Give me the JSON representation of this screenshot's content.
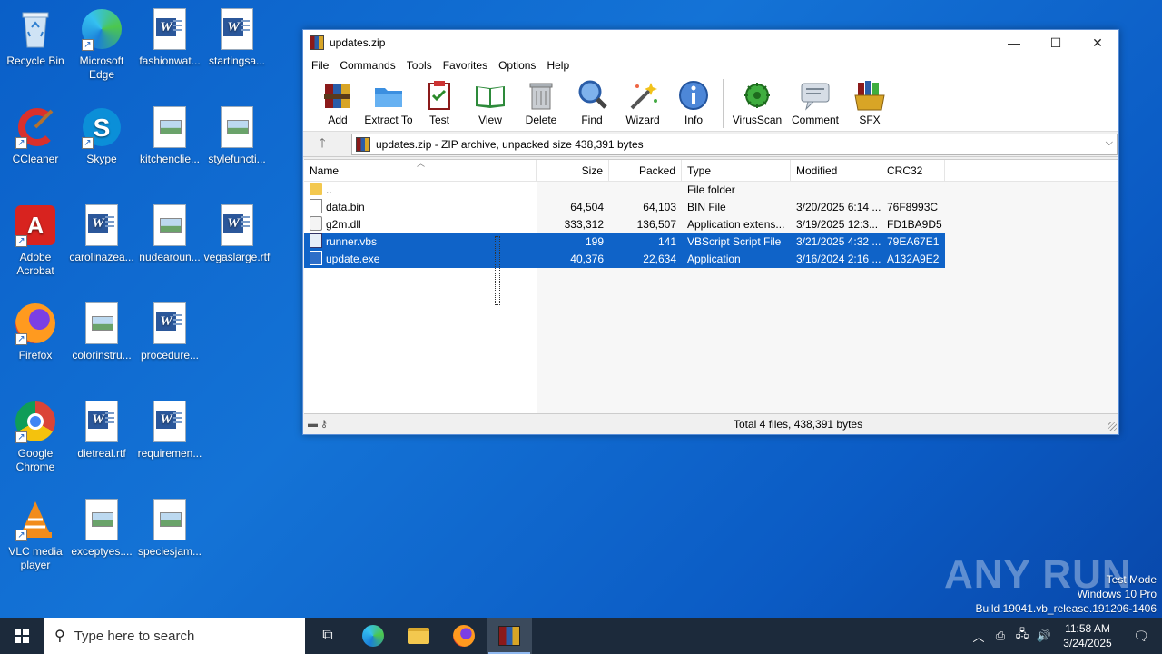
{
  "desktop": {
    "icons": [
      {
        "label": "Recycle Bin"
      },
      {
        "label": "Microsoft Edge"
      },
      {
        "label": "fashionwat..."
      },
      {
        "label": "startingsa..."
      },
      {
        "label": "CCleaner"
      },
      {
        "label": "Skype"
      },
      {
        "label": "kitchenclie..."
      },
      {
        "label": "stylefuncti..."
      },
      {
        "label": "Adobe Acrobat"
      },
      {
        "label": "carolinazea..."
      },
      {
        "label": "nudearoun..."
      },
      {
        "label": "vegaslarge.rtf"
      },
      {
        "label": "Firefox"
      },
      {
        "label": "colorinstru..."
      },
      {
        "label": "procedure..."
      },
      {
        "label": "Google Chrome"
      },
      {
        "label": "dietreal.rtf"
      },
      {
        "label": "requiremen..."
      },
      {
        "label": "VLC media player"
      },
      {
        "label": "exceptyes...."
      },
      {
        "label": "speciesjam..."
      }
    ]
  },
  "window": {
    "title": "updates.zip",
    "menu": [
      "File",
      "Commands",
      "Tools",
      "Favorites",
      "Options",
      "Help"
    ],
    "toolbar": [
      "Add",
      "Extract To",
      "Test",
      "View",
      "Delete",
      "Find",
      "Wizard",
      "Info",
      "VirusScan",
      "Comment",
      "SFX"
    ],
    "address": "updates.zip - ZIP archive, unpacked size 438,391 bytes",
    "columns": [
      "Name",
      "Size",
      "Packed",
      "Type",
      "Modified",
      "CRC32"
    ],
    "files": [
      {
        "name": "..",
        "size": "",
        "packed": "",
        "type": "File folder",
        "modified": "",
        "crc": ""
      },
      {
        "name": "data.bin",
        "size": "64,504",
        "packed": "64,103",
        "type": "BIN File",
        "modified": "3/20/2025 6:14 ...",
        "crc": "76F8993C"
      },
      {
        "name": "g2m.dll",
        "size": "333,312",
        "packed": "136,507",
        "type": "Application extens...",
        "modified": "3/19/2025 12:3...",
        "crc": "FD1BA9D5"
      },
      {
        "name": "runner.vbs",
        "size": "199",
        "packed": "141",
        "type": "VBScript Script File",
        "modified": "3/21/2025 4:32 ...",
        "crc": "79EA67E1"
      },
      {
        "name": "update.exe",
        "size": "40,376",
        "packed": "22,634",
        "type": "Application",
        "modified": "3/16/2024 2:16 ...",
        "crc": "A132A9E2"
      }
    ],
    "status": "Total 4 files, 438,391 bytes"
  },
  "taskbar": {
    "search_placeholder": "Type here to search",
    "time": "11:58 AM",
    "date": "3/24/2025"
  },
  "watermark": {
    "line1": "Test Mode",
    "line2": "Windows 10 Pro",
    "line3": "Build 19041.vb_release.191206-1406",
    "brand": "ANY RUN"
  }
}
